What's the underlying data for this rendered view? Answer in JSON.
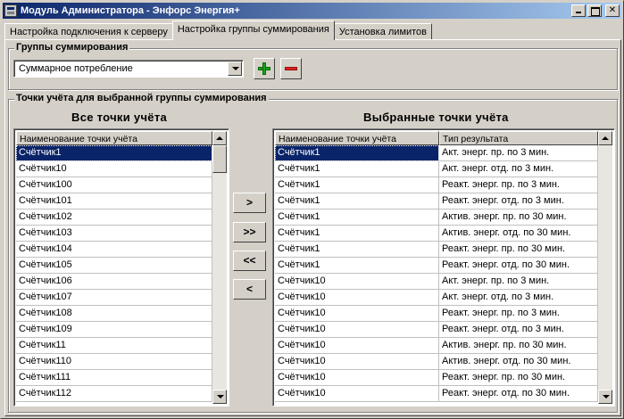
{
  "window": {
    "title": "Модуль Администратора - Энфорс Энергия+",
    "icon": "app-icon"
  },
  "tabs": [
    {
      "label": "Настройка подключения к серверу",
      "active": false
    },
    {
      "label": "Настройка группы суммирования",
      "active": true
    },
    {
      "label": "Установка лимитов",
      "active": false
    }
  ],
  "groups_box": {
    "legend": "Группы суммирования",
    "selected_group": "Суммарное потребление",
    "add_icon": "plus-icon",
    "remove_icon": "minus-icon"
  },
  "points_box": {
    "legend": "Точки учёта для выбранной группы суммирования"
  },
  "all_points": {
    "title": "Все точки учёта",
    "columns": [
      "Наименование точки учёта"
    ],
    "selected_index": 0,
    "rows": [
      "Счётчик1",
      "Счётчик10",
      "Счётчик100",
      "Счётчик101",
      "Счётчик102",
      "Счётчик103",
      "Счётчик104",
      "Счётчик105",
      "Счётчик106",
      "Счётчик107",
      "Счётчик108",
      "Счётчик109",
      "Счётчик11",
      "Счётчик110",
      "Счётчик111",
      "Счётчик112"
    ]
  },
  "move_buttons": {
    "add_one": ">",
    "add_all": ">>",
    "remove_all": "<<",
    "remove_one": "<"
  },
  "selected_points": {
    "title": "Выбранные точки учёта",
    "columns": [
      "Наименование точки учёта",
      "Тип результата"
    ],
    "selected_index": 0,
    "rows": [
      [
        "Счётчик1",
        "Акт. энерг. пр. по 3 мин."
      ],
      [
        "Счётчик1",
        "Акт. энерг. отд. по 3 мин."
      ],
      [
        "Счётчик1",
        "Реакт. энерг. пр. по 3 мин."
      ],
      [
        "Счётчик1",
        "Реакт. энерг. отд. по 3 мин."
      ],
      [
        "Счётчик1",
        "Актив. энерг. пр. по 30 мин."
      ],
      [
        "Счётчик1",
        "Актив. энерг. отд. по 30 мин."
      ],
      [
        "Счётчик1",
        "Реакт. энерг. пр. по 30 мин."
      ],
      [
        "Счётчик1",
        "Реакт. энерг. отд. по 30 мин."
      ],
      [
        "Счётчик10",
        "Акт. энерг. пр. по 3 мин."
      ],
      [
        "Счётчик10",
        "Акт. энерг. отд. по 3 мин."
      ],
      [
        "Счётчик10",
        "Реакт. энерг. пр. по 3 мин."
      ],
      [
        "Счётчик10",
        "Реакт. энерг. отд. по 3 мин."
      ],
      [
        "Счётчик10",
        "Актив. энерг. пр. по 30 мин."
      ],
      [
        "Счётчик10",
        "Актив. энерг. отд. по 30 мин."
      ],
      [
        "Счётчик10",
        "Реакт. энерг. пр. по 30 мин."
      ],
      [
        "Счётчик10",
        "Реакт. энерг. отд. по 30 мин."
      ]
    ]
  }
}
